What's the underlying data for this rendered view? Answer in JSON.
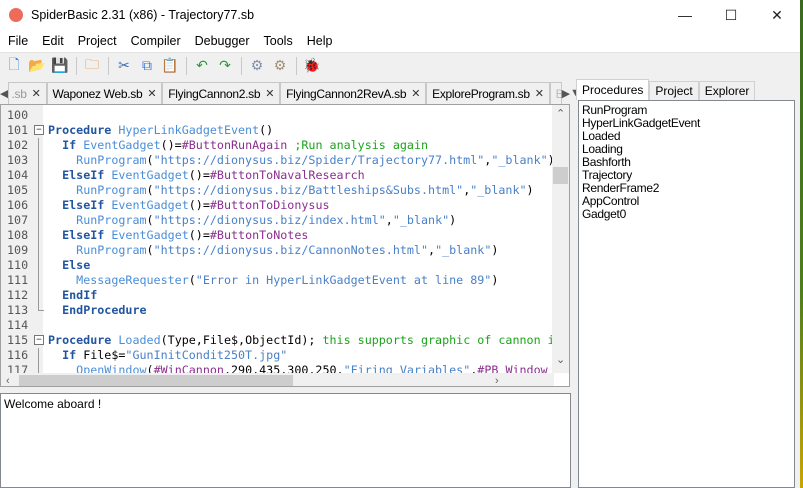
{
  "window": {
    "title": "SpiderBasic 2.31 (x86) - Trajectory77.sb",
    "controls": [
      "—",
      "☐",
      "✕"
    ]
  },
  "menu": [
    "File",
    "Edit",
    "Project",
    "Compiler",
    "Debugger",
    "Tools",
    "Help"
  ],
  "toolbar": [
    {
      "icon": "new-file-icon",
      "glyph": "🗋",
      "color": "#3a7bd5"
    },
    {
      "icon": "open-file-icon",
      "glyph": "📂",
      "color": "#e0a030"
    },
    {
      "icon": "save-icon",
      "glyph": "💾",
      "color": "#3a6fb5"
    },
    {
      "sep": true
    },
    {
      "icon": "close-file-icon",
      "glyph": "🗀",
      "color": "#e08020"
    },
    {
      "sep": true
    },
    {
      "icon": "cut-icon",
      "glyph": "✂",
      "color": "#3a6fb5"
    },
    {
      "icon": "copy-icon",
      "glyph": "⧉",
      "color": "#3a7bd5"
    },
    {
      "icon": "paste-icon",
      "glyph": "📋",
      "color": "#a07040"
    },
    {
      "sep": true
    },
    {
      "icon": "undo-icon",
      "glyph": "↶",
      "color": "#2a9a3a"
    },
    {
      "icon": "redo-icon",
      "glyph": "↷",
      "color": "#2a9a3a"
    },
    {
      "sep": true
    },
    {
      "icon": "compile-run-icon",
      "glyph": "⚙",
      "color": "#8090a8"
    },
    {
      "icon": "compiler-options-icon",
      "glyph": "⚙",
      "color": "#a09070"
    },
    {
      "sep": true
    },
    {
      "icon": "debugger-bug-icon",
      "glyph": "🐞",
      "color": "#4a8a2a"
    }
  ],
  "file_tabs": [
    ".sb",
    "Waponez Web.sb",
    "FlyingCannon2.sb",
    "FlyingCannon2RevA.sb",
    "ExploreProgram.sb",
    "B"
  ],
  "code_lines": [
    {
      "n": "100",
      "fold": "",
      "t": []
    },
    {
      "n": "101",
      "fold": "box",
      "t": [
        [
          "kw",
          "Procedure"
        ],
        [
          "op",
          " "
        ],
        [
          "fn",
          "HyperLinkGadgetEvent"
        ],
        [
          "op",
          "()"
        ]
      ]
    },
    {
      "n": "102",
      "fold": "line",
      "t": [
        [
          "op",
          "  "
        ],
        [
          "kw",
          "If"
        ],
        [
          "op",
          " "
        ],
        [
          "fn",
          "EventGadget"
        ],
        [
          "op",
          "()="
        ],
        [
          "cn",
          "#ButtonRunAgain"
        ],
        [
          "op",
          " "
        ],
        [
          "cm",
          ";Run analysis again"
        ]
      ]
    },
    {
      "n": "103",
      "fold": "line",
      "t": [
        [
          "op",
          "    "
        ],
        [
          "fn",
          "RunProgram"
        ],
        [
          "op",
          "("
        ],
        [
          "st",
          "\"https://dionysus.biz/Spider/Trajectory77.html\""
        ],
        [
          "op",
          ","
        ],
        [
          "st",
          "\"_blank\""
        ],
        [
          "op",
          ")"
        ]
      ]
    },
    {
      "n": "104",
      "fold": "line",
      "t": [
        [
          "op",
          "  "
        ],
        [
          "kw",
          "ElseIf"
        ],
        [
          "op",
          " "
        ],
        [
          "fn",
          "EventGadget"
        ],
        [
          "op",
          "()="
        ],
        [
          "cn",
          "#ButtonToNavalResearch"
        ]
      ]
    },
    {
      "n": "105",
      "fold": "line",
      "t": [
        [
          "op",
          "    "
        ],
        [
          "fn",
          "RunProgram"
        ],
        [
          "op",
          "("
        ],
        [
          "st",
          "\"https://dionysus.biz/Battleships&Subs.html\""
        ],
        [
          "op",
          ","
        ],
        [
          "st",
          "\"_blank\""
        ],
        [
          "op",
          ")"
        ]
      ]
    },
    {
      "n": "106",
      "fold": "line",
      "t": [
        [
          "op",
          "  "
        ],
        [
          "kw",
          "ElseIf"
        ],
        [
          "op",
          " "
        ],
        [
          "fn",
          "EventGadget"
        ],
        [
          "op",
          "()="
        ],
        [
          "cn",
          "#ButtonToDionysus"
        ]
      ]
    },
    {
      "n": "107",
      "fold": "line",
      "t": [
        [
          "op",
          "    "
        ],
        [
          "fn",
          "RunProgram"
        ],
        [
          "op",
          "("
        ],
        [
          "st",
          "\"https://dionysus.biz/index.html\""
        ],
        [
          "op",
          ","
        ],
        [
          "st",
          "\"_blank\""
        ],
        [
          "op",
          ")"
        ]
      ]
    },
    {
      "n": "108",
      "fold": "line",
      "t": [
        [
          "op",
          "  "
        ],
        [
          "kw",
          "ElseIf"
        ],
        [
          "op",
          " "
        ],
        [
          "fn",
          "EventGadget"
        ],
        [
          "op",
          "()="
        ],
        [
          "cn",
          "#ButtonToNotes"
        ]
      ]
    },
    {
      "n": "109",
      "fold": "line",
      "t": [
        [
          "op",
          "    "
        ],
        [
          "fn",
          "RunProgram"
        ],
        [
          "op",
          "("
        ],
        [
          "st",
          "\"https://dionysus.biz/CannonNotes.html\""
        ],
        [
          "op",
          ","
        ],
        [
          "st",
          "\"_blank\""
        ],
        [
          "op",
          ")"
        ]
      ]
    },
    {
      "n": "110",
      "fold": "line",
      "t": [
        [
          "op",
          "  "
        ],
        [
          "kw",
          "Else"
        ]
      ]
    },
    {
      "n": "111",
      "fold": "line",
      "t": [
        [
          "op",
          "    "
        ],
        [
          "fn",
          "MessageRequester"
        ],
        [
          "op",
          "("
        ],
        [
          "st",
          "\"Error in HyperLinkGadgetEvent at line 89\""
        ],
        [
          "op",
          ")"
        ]
      ]
    },
    {
      "n": "112",
      "fold": "line",
      "t": [
        [
          "op",
          "  "
        ],
        [
          "kw",
          "EndIf"
        ]
      ]
    },
    {
      "n": "113",
      "fold": "end",
      "t": [
        [
          "op",
          "  "
        ],
        [
          "kw",
          "EndProcedure"
        ]
      ]
    },
    {
      "n": "114",
      "fold": "",
      "t": []
    },
    {
      "n": "115",
      "fold": "box",
      "t": [
        [
          "kw",
          "Procedure"
        ],
        [
          "op",
          " "
        ],
        [
          "fn",
          "Loaded"
        ],
        [
          "op",
          "(Type,File$,ObjectId); "
        ],
        [
          "cm",
          "this supports graphic of cannon i"
        ]
      ]
    },
    {
      "n": "116",
      "fold": "line",
      "t": [
        [
          "op",
          "  "
        ],
        [
          "kw",
          "If"
        ],
        [
          "op",
          " File$="
        ],
        [
          "st",
          "\"GunInitCondit250T.jpg\""
        ]
      ]
    },
    {
      "n": "117",
      "fold": "line",
      "t": [
        [
          "op",
          "    "
        ],
        [
          "fn",
          "OpenWindow"
        ],
        [
          "op",
          "("
        ],
        [
          "cn",
          "#WinCannon"
        ],
        [
          "op",
          ",290,435,300,250,"
        ],
        [
          "st",
          "\"Firing Variables\""
        ],
        [
          "op",
          ","
        ],
        [
          "cn",
          "#PB_Window"
        ]
      ]
    }
  ],
  "log": {
    "text": "Welcome aboard !"
  },
  "panel": {
    "tabs": [
      "Procedures",
      "Project",
      "Explorer"
    ],
    "active": "Procedures",
    "procedures": [
      "RunProgram",
      "HyperLinkGadgetEvent",
      "Loaded",
      "Loading",
      "Bashforth",
      "Trajectory",
      "RenderFrame2",
      "AppControl",
      "Gadget0"
    ]
  }
}
